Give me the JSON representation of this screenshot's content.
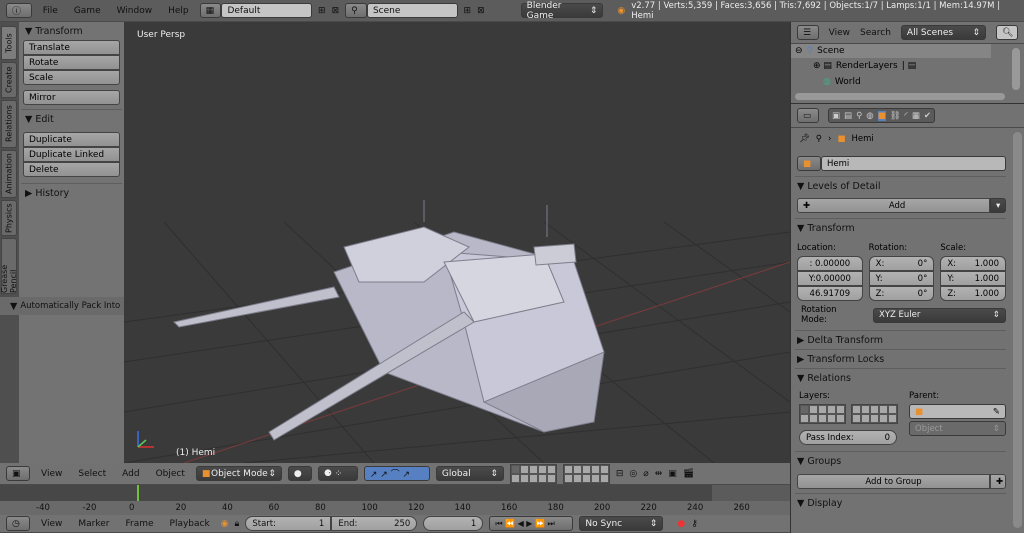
{
  "topbar": {
    "menus": [
      "File",
      "Game",
      "Window",
      "Help"
    ],
    "layout": "Default",
    "scene": "Scene",
    "engine": "Blender Game",
    "stats": "v2.77 | Verts:5,359 | Faces:3,656 | Tris:7,692 | Objects:1/7 | Lamps:1/1 | Mem:14.97M | Hemi"
  },
  "tool_tabs": [
    "Tools",
    "Create",
    "Relations",
    "Animation",
    "Physics",
    "Grease Pencil"
  ],
  "tools": {
    "transform_title": "Transform",
    "transform": [
      "Translate",
      "Rotate",
      "Scale"
    ],
    "mirror": "Mirror",
    "edit_title": "Edit",
    "edit": [
      "Duplicate",
      "Duplicate Linked",
      "Delete"
    ],
    "history": "History",
    "auto_pack": "Automatically Pack Into"
  },
  "viewport": {
    "label": "User Persp",
    "object_label": "(1) Hemi"
  },
  "view3d_header": {
    "menus": [
      "View",
      "Select",
      "Add",
      "Object"
    ],
    "mode": "Object Mode",
    "orientation": "Global"
  },
  "timeline": {
    "ticks": [
      "-40",
      "-20",
      "0",
      "20",
      "40",
      "60",
      "80",
      "100",
      "120",
      "140",
      "160",
      "180",
      "200",
      "220",
      "240",
      "260"
    ],
    "menus": [
      "View",
      "Marker",
      "Frame",
      "Playback"
    ],
    "start_label": "Start:",
    "start": "1",
    "end_label": "End:",
    "end": "250",
    "current": "1",
    "sync": "No Sync"
  },
  "outliner": {
    "view": "View",
    "search": "Search",
    "filter": "All Scenes",
    "items": [
      "Scene",
      "RenderLayers",
      "World"
    ]
  },
  "properties": {
    "breadcrumb": "Hemi",
    "object_name": "Hemi",
    "lod": "Levels of Detail",
    "add": "Add",
    "transform": "Transform",
    "location_label": "Location:",
    "rotation_label": "Rotation:",
    "scale_label": "Scale:",
    "location": [
      ": 0.00000",
      "Y:0.00000",
      "46.91709"
    ],
    "rotation": [
      [
        "X:",
        "0°"
      ],
      [
        "Y:",
        "0°"
      ],
      [
        "Z:",
        "0°"
      ]
    ],
    "scale": [
      [
        "X:",
        "1.000"
      ],
      [
        "Y:",
        "1.000"
      ],
      [
        "Z:",
        "1.000"
      ]
    ],
    "rotation_mode_label": "Rotation Mode:",
    "rotation_mode": "XYZ Euler",
    "delta": "Delta Transform",
    "locks": "Transform Locks",
    "relations": "Relations",
    "layers_label": "Layers:",
    "parent_label": "Parent:",
    "parent_type": "Object",
    "pass_index_label": "Pass Index:",
    "pass_index": "0",
    "groups": "Groups",
    "add_to_group": "Add to Group",
    "display": "Display"
  },
  "colors": {
    "accent_blue": "#5680c2",
    "frame_green": "#6fc03a",
    "object_orange": "#e8912e"
  }
}
